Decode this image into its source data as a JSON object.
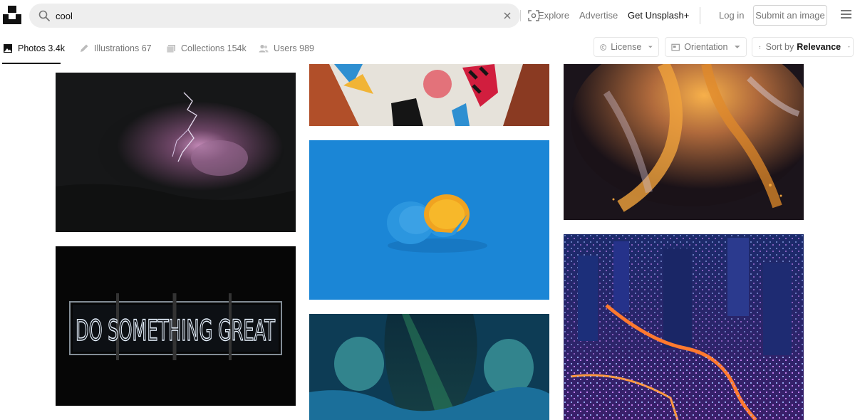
{
  "search": {
    "value": "cool"
  },
  "nav": {
    "explore": "Explore",
    "advertise": "Advertise",
    "get_plus": "Get Unsplash+",
    "login": "Log in",
    "submit": "Submit an image"
  },
  "tabs": [
    {
      "label": "Photos 3.4k",
      "icon": "image-icon",
      "active": true
    },
    {
      "label": "Illustrations 67",
      "icon": "pen-icon",
      "active": false
    },
    {
      "label": "Collections 154k",
      "icon": "collection-icon",
      "active": false
    },
    {
      "label": "Users 989",
      "icon": "users-icon",
      "active": false
    }
  ],
  "filters": {
    "license": "License",
    "orientation": "Orientation",
    "sort_prefix": "Sort by",
    "sort_value": "Relevance"
  },
  "photos": [
    {
      "subject": "lightning-storm"
    },
    {
      "subject": "do-something-great-neon"
    },
    {
      "subject": "knit-pattern"
    },
    {
      "subject": "blue-orange"
    },
    {
      "subject": "cave-aurora"
    },
    {
      "subject": "orange-smoke-swirl"
    },
    {
      "subject": "tokyo-night-city"
    }
  ],
  "neon_sign": {
    "text": "DO SOMETHING GREAT"
  },
  "colors": {
    "accent": "#111111",
    "muted": "#767676",
    "border": "#d1d1d1",
    "search_bg": "#eeeeee"
  }
}
